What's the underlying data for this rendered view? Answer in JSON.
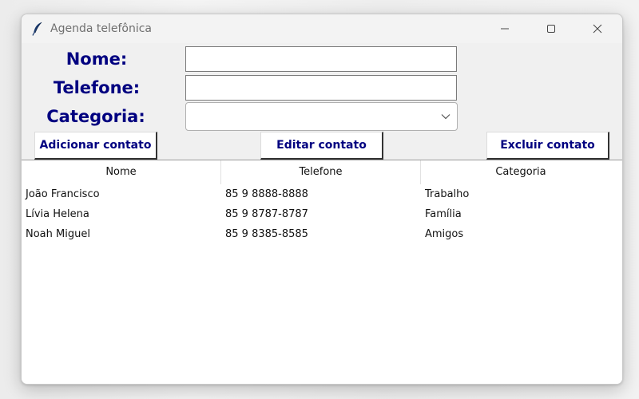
{
  "window": {
    "title": "Agenda telefônica",
    "icon": "feather-icon"
  },
  "titlebar_buttons": [
    "minimize-icon",
    "maximize-icon",
    "close-icon"
  ],
  "form": {
    "nome_label": "Nome:",
    "telefone_label": "Telefone:",
    "categoria_label": "Categoria:",
    "nome_value": "",
    "telefone_value": "",
    "categoria_value": ""
  },
  "buttons": {
    "add": "Adicionar contato",
    "edit": "Editar contato",
    "delete": "Excluir contato"
  },
  "table": {
    "columns": [
      "Nome",
      "Telefone",
      "Categoria"
    ],
    "rows": [
      [
        "João Francisco",
        "85 9 8888-8888",
        "Trabalho"
      ],
      [
        "Lívia Helena",
        "85 9 8787-8787",
        "Família"
      ],
      [
        "Noah Miguel",
        "85 9 8385-8585",
        "Amigos"
      ]
    ]
  },
  "colors": {
    "label_text": "#000080",
    "window_bg": "#f0f0f0",
    "table_bg": "#ffffff"
  }
}
